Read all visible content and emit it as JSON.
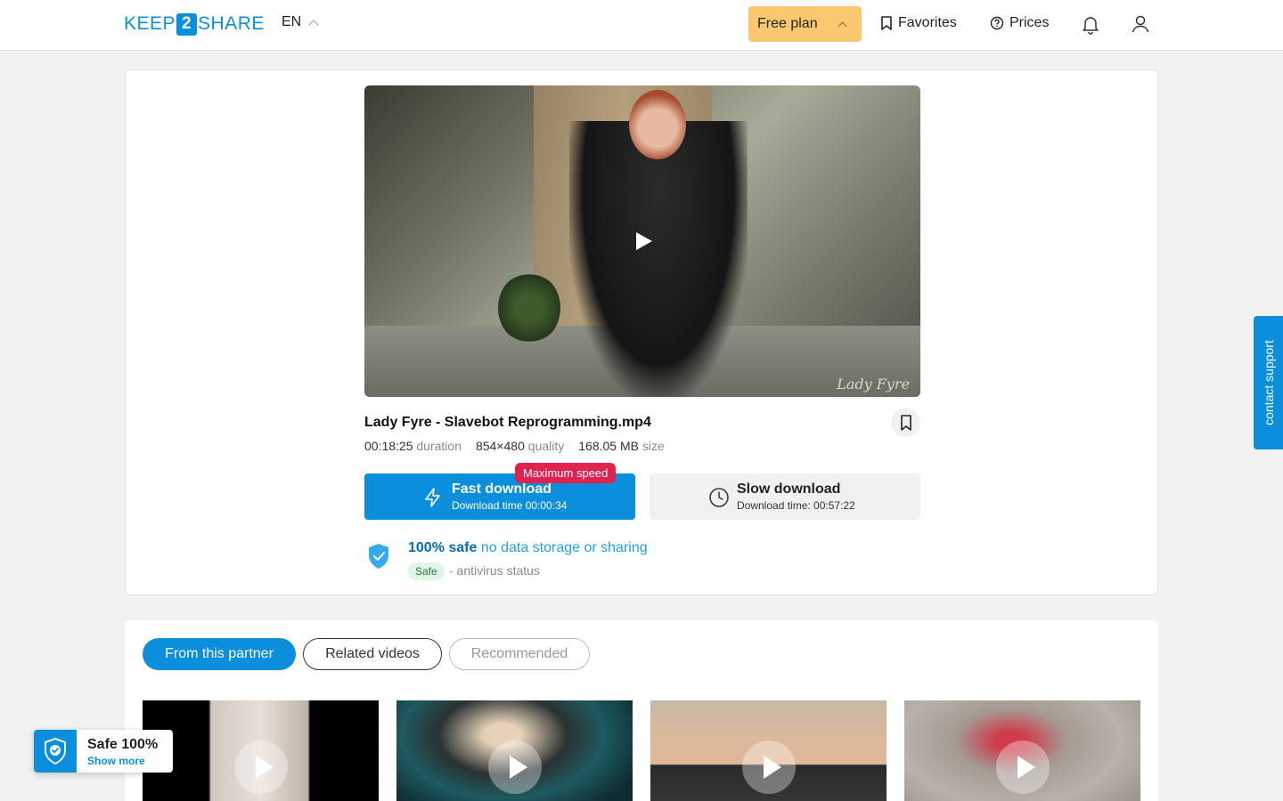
{
  "header": {
    "logo_left": "KEEP",
    "logo_mid": "2",
    "logo_right": "SHARE",
    "language": "EN",
    "plan_label": "Free plan",
    "favorites_label": "Favorites",
    "prices_label": "Prices"
  },
  "file": {
    "title": "Lady Fyre - Slavebot Reprogramming.mp4",
    "watermark": "Lady Fyre",
    "duration_value": "00:18:25",
    "duration_label": "duration",
    "quality_value": "854×480",
    "quality_label": "quality",
    "size_value": "168.05 MB",
    "size_label": "size"
  },
  "download": {
    "fast_label": "Fast download",
    "fast_time": "Download time 00:00:34",
    "fast_badge": "Maximum speed",
    "slow_label": "Slow download",
    "slow_time": "Download time: 00:57:22"
  },
  "safety": {
    "headline_strong": "100% safe",
    "headline_light": "no data storage or sharing",
    "badge": "Safe",
    "status": "- antivirus status"
  },
  "support": {
    "label": "contact support"
  },
  "tabs": [
    {
      "label": "From this partner",
      "active": true
    },
    {
      "label": "Related videos",
      "active": false
    },
    {
      "label": "Recommended",
      "active": false
    }
  ],
  "popup": {
    "title": "Safe 100%",
    "link": "Show more"
  },
  "colors": {
    "accent": "#0b8fdc",
    "plan": "#fcc86f",
    "badge": "#e0224f"
  }
}
